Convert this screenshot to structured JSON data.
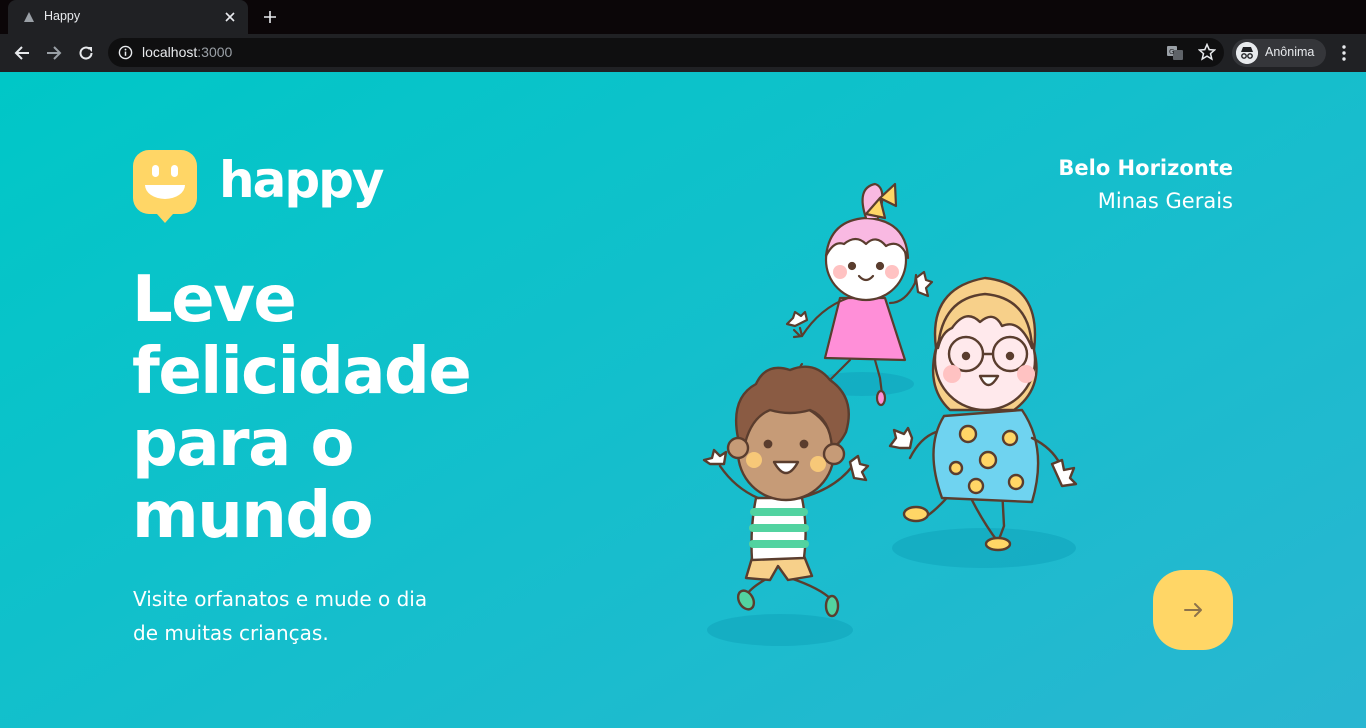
{
  "browser": {
    "tab_title": "Happy",
    "url_host": "localhost",
    "url_port": ":3000",
    "profile_label": "Anônima"
  },
  "landing": {
    "logo_text": "happy",
    "headline_lines": [
      "Leve",
      "felicidade",
      "para o",
      "mundo"
    ],
    "subtitle_lines": [
      "Visite orfanatos e mude o dia",
      "de muitas crianças."
    ],
    "location": {
      "city": "Belo Horizonte",
      "state": "Minas Gerais"
    },
    "enter_button_icon": "arrow-right-icon"
  },
  "colors": {
    "gradient_start": "#00c7c7",
    "gradient_end": "#29b6d1",
    "logo_yellow": "#ffd666",
    "button_yellow": "#ffd666",
    "arrow_color": "#8d734b",
    "text": "#ffffff"
  }
}
